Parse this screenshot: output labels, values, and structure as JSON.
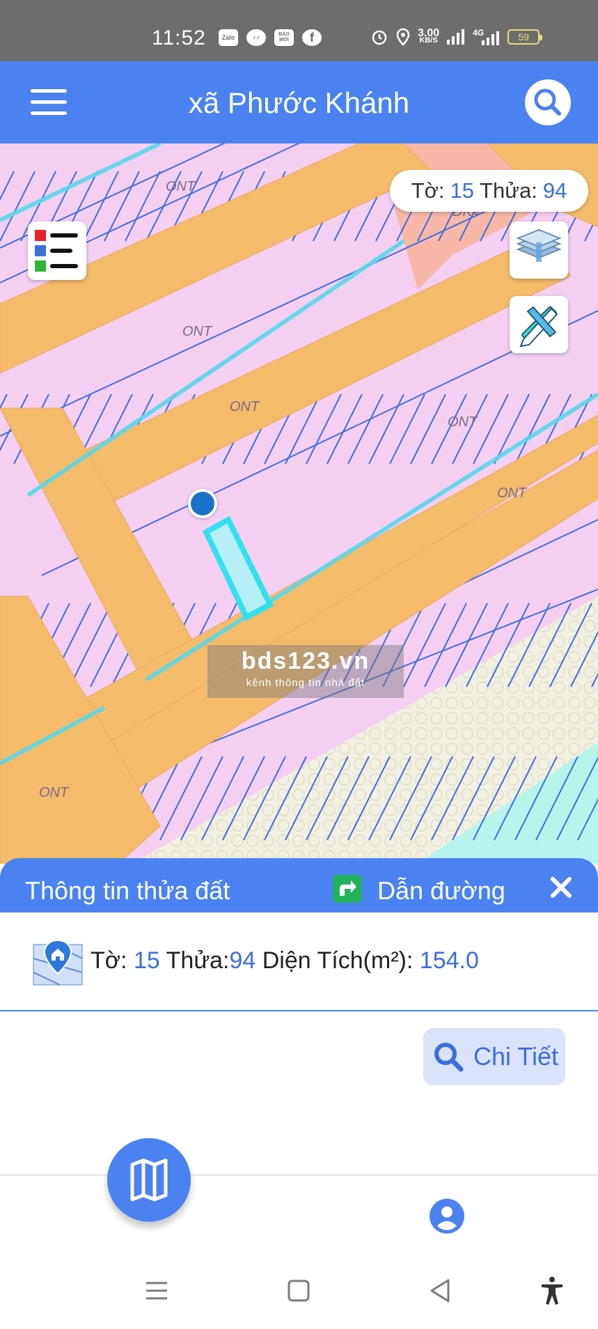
{
  "status_bar": {
    "time": "11:52",
    "apps": [
      {
        "icon": "zalo-icon",
        "label": "Zalo"
      },
      {
        "icon": "messenger-icon",
        "label": ""
      },
      {
        "icon": "baomoi-icon",
        "label": "BÁO MỚI"
      },
      {
        "icon": "facebook-icon",
        "label": "f"
      }
    ],
    "speed_value": "3.00",
    "speed_unit": "KB/S",
    "network": "4G",
    "battery": "59"
  },
  "app_bar": {
    "title": "xã Phước Khánh",
    "menu_icon": "hamburger-menu-icon",
    "search_icon": "search-icon"
  },
  "map": {
    "sheet_label": "Tờ:",
    "sheet_value": "15",
    "parcel_label": "Thửa:",
    "parcel_value": "94",
    "zone_labels": [
      "ONT",
      "ONT",
      "ONT",
      "ONT",
      "ONT",
      "ONT",
      "ONT",
      "DKV"
    ],
    "watermark_main": "bds123.vn",
    "watermark_sub": "kênh thông tin nhà đất",
    "legend_icon": "legend-icon",
    "layers_icon": "layers-icon",
    "measure_icon": "measure-tool-icon",
    "colors": {
      "residential": "#f5cff2",
      "road": "#f4bb6a",
      "parcel_line": "#3d6fe0",
      "special_use": "#f7b8a8",
      "water": "#b6f4ec",
      "other_land": "#f2f0e2",
      "selected": "#33e0f0"
    }
  },
  "info_panel": {
    "title": "Thông tin thửa đất",
    "directions_label": "Dẫn đường",
    "directions_icon": "directions-icon",
    "close_icon": "close-icon",
    "parcel_icon": "parcel-location-icon",
    "sheet_label": "Tờ:",
    "sheet_value": "15",
    "parcel_label": "Thửa:",
    "parcel_value": "94",
    "area_label": "Diện Tích(m²):",
    "area_value": "154.0",
    "detail_label": "Chi Tiết"
  },
  "bottom_nav": {
    "map_icon": "map-icon",
    "profile_icon": "profile-icon"
  },
  "system_nav": {
    "menu_icon": "recent-apps-icon",
    "home_icon": "home-icon",
    "back_icon": "back-icon",
    "accessibility_icon": "accessibility-icon"
  },
  "accent_color": "#4a82f2"
}
